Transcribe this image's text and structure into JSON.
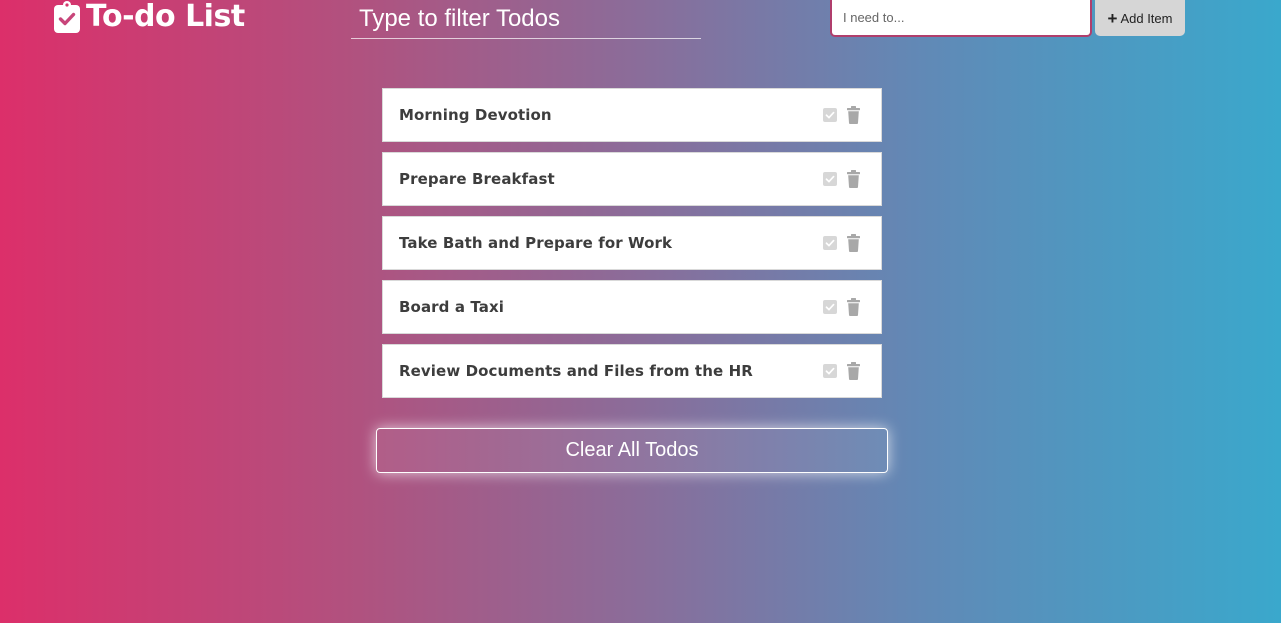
{
  "header": {
    "logo_icon": "clipboard-check-icon",
    "title": "To-do List",
    "filter_placeholder": "Type to filter Todos",
    "add_input_placeholder": "I need to...",
    "add_button_icon": "plus-icon",
    "add_button_label": "Add Item"
  },
  "todos": [
    {
      "text": "Morning Devotion"
    },
    {
      "text": "Prepare Breakfast"
    },
    {
      "text": "Take Bath and Prepare for Work"
    },
    {
      "text": "Board a Taxi"
    },
    {
      "text": "Review Documents and Files from the HR"
    }
  ],
  "todo_icons": {
    "complete": "check-square-icon",
    "delete": "trash-icon"
  },
  "clear_button_label": "Clear All Todos",
  "colors": {
    "gradient_start": "#dc2f6a",
    "gradient_end": "#3aa8cc",
    "todo_text": "#3d3d3d",
    "icon_gray": "#a8a8a8"
  }
}
